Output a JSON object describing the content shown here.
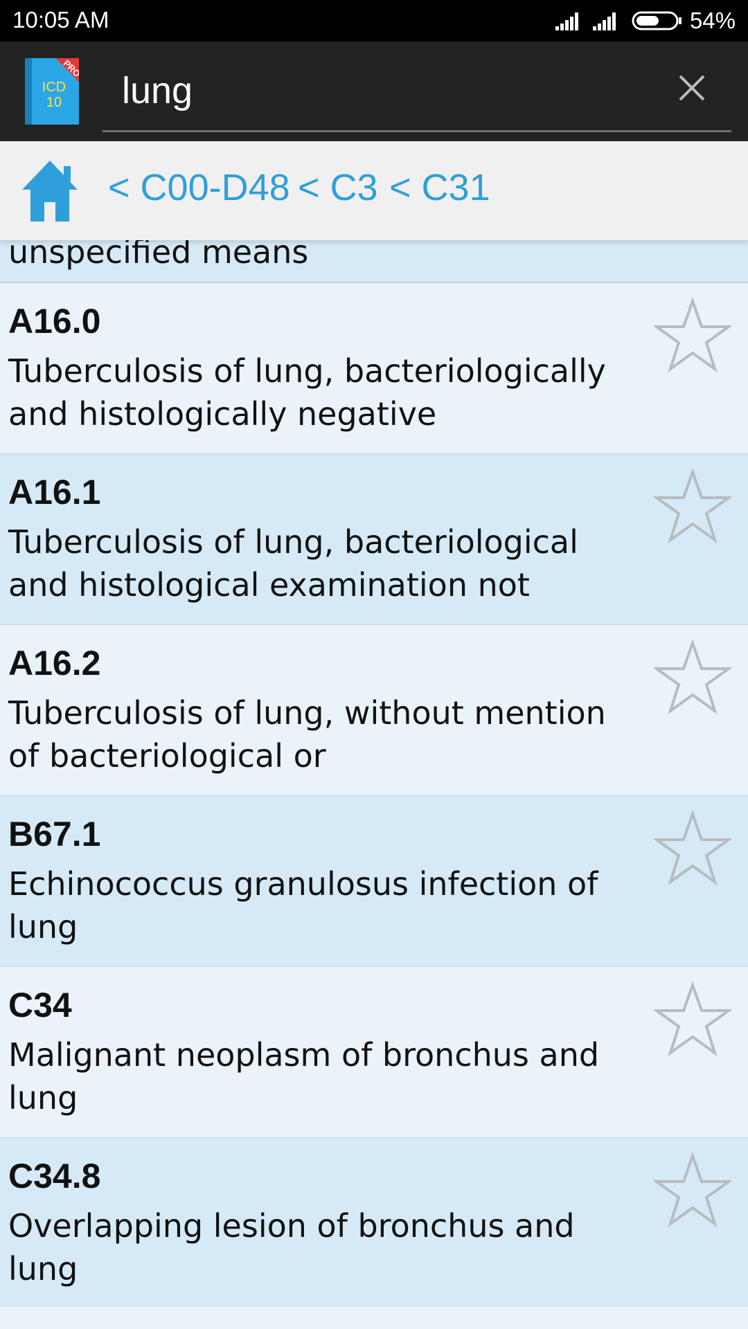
{
  "status_bar": {
    "time": "10:05 AM",
    "battery": "54%"
  },
  "app_bar": {
    "logo_text_line1": "ICD",
    "logo_text_line2": "10",
    "logo_badge": "PRO",
    "search_value": "lung"
  },
  "breadcrumbs": [
    "< C00-D48",
    "< C3",
    "< C31"
  ],
  "partial_row_text": "unspecified means",
  "results": [
    {
      "code": "A16.0",
      "description": "Tuberculosis of lung,  bacteriologically and histologically negative"
    },
    {
      "code": "A16.1",
      "description": "Tuberculosis of lung,  bacteriological and histological examination not"
    },
    {
      "code": "A16.2",
      "description": "Tuberculosis of lung,  without mention of bacteriological or"
    },
    {
      "code": "B67.1",
      "description": "Echinococcus granulosus infection of lung"
    },
    {
      "code": "C34",
      "description": "Malignant neoplasm of bronchus and lung"
    },
    {
      "code": "C34.8",
      "description": "Overlapping lesion of bronchus and lung"
    }
  ],
  "colors": {
    "accent": "#2e9fda",
    "app_bar": "#222222",
    "row_light": "#eaf3fa",
    "row_blue": "#d5eaf6"
  }
}
